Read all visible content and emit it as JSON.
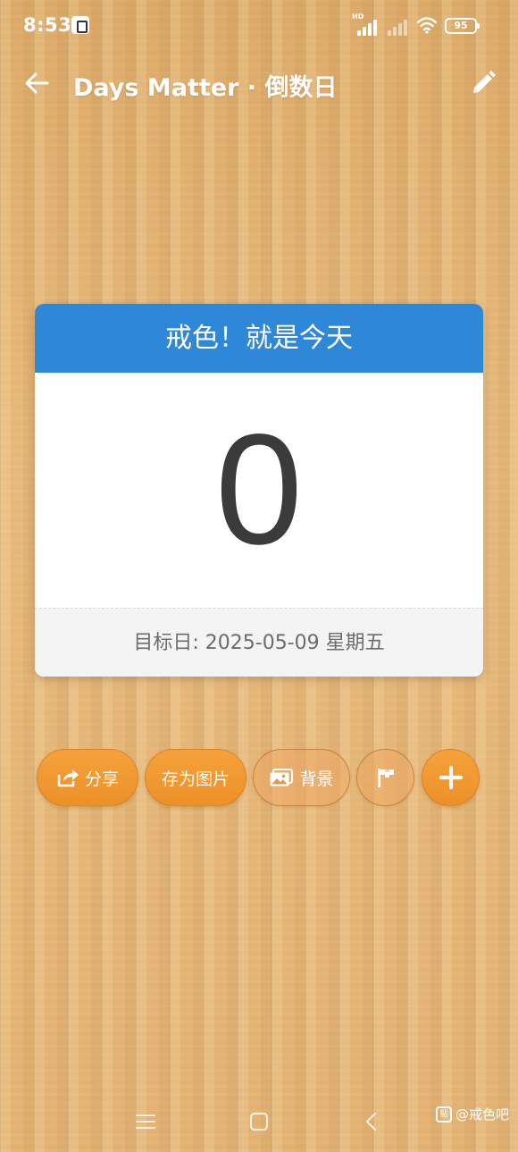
{
  "status_bar": {
    "time": "8:53",
    "network_label": "HD",
    "battery": "95"
  },
  "app_bar": {
    "title": "Days Matter · 倒数日",
    "back_icon": "arrow-left-icon",
    "edit_icon": "pencil-icon"
  },
  "card": {
    "title": "戒色！就是今天",
    "days": "0",
    "target_date": "目标日: 2025-05-09 星期五",
    "header_color": "#2f87d8"
  },
  "actions": {
    "share_label": "分享",
    "save_image_label": "存为图片",
    "background_label": "背景",
    "accent_color": "#f29a33"
  },
  "watermark": {
    "logo": "贴",
    "text": "@戒色吧"
  }
}
